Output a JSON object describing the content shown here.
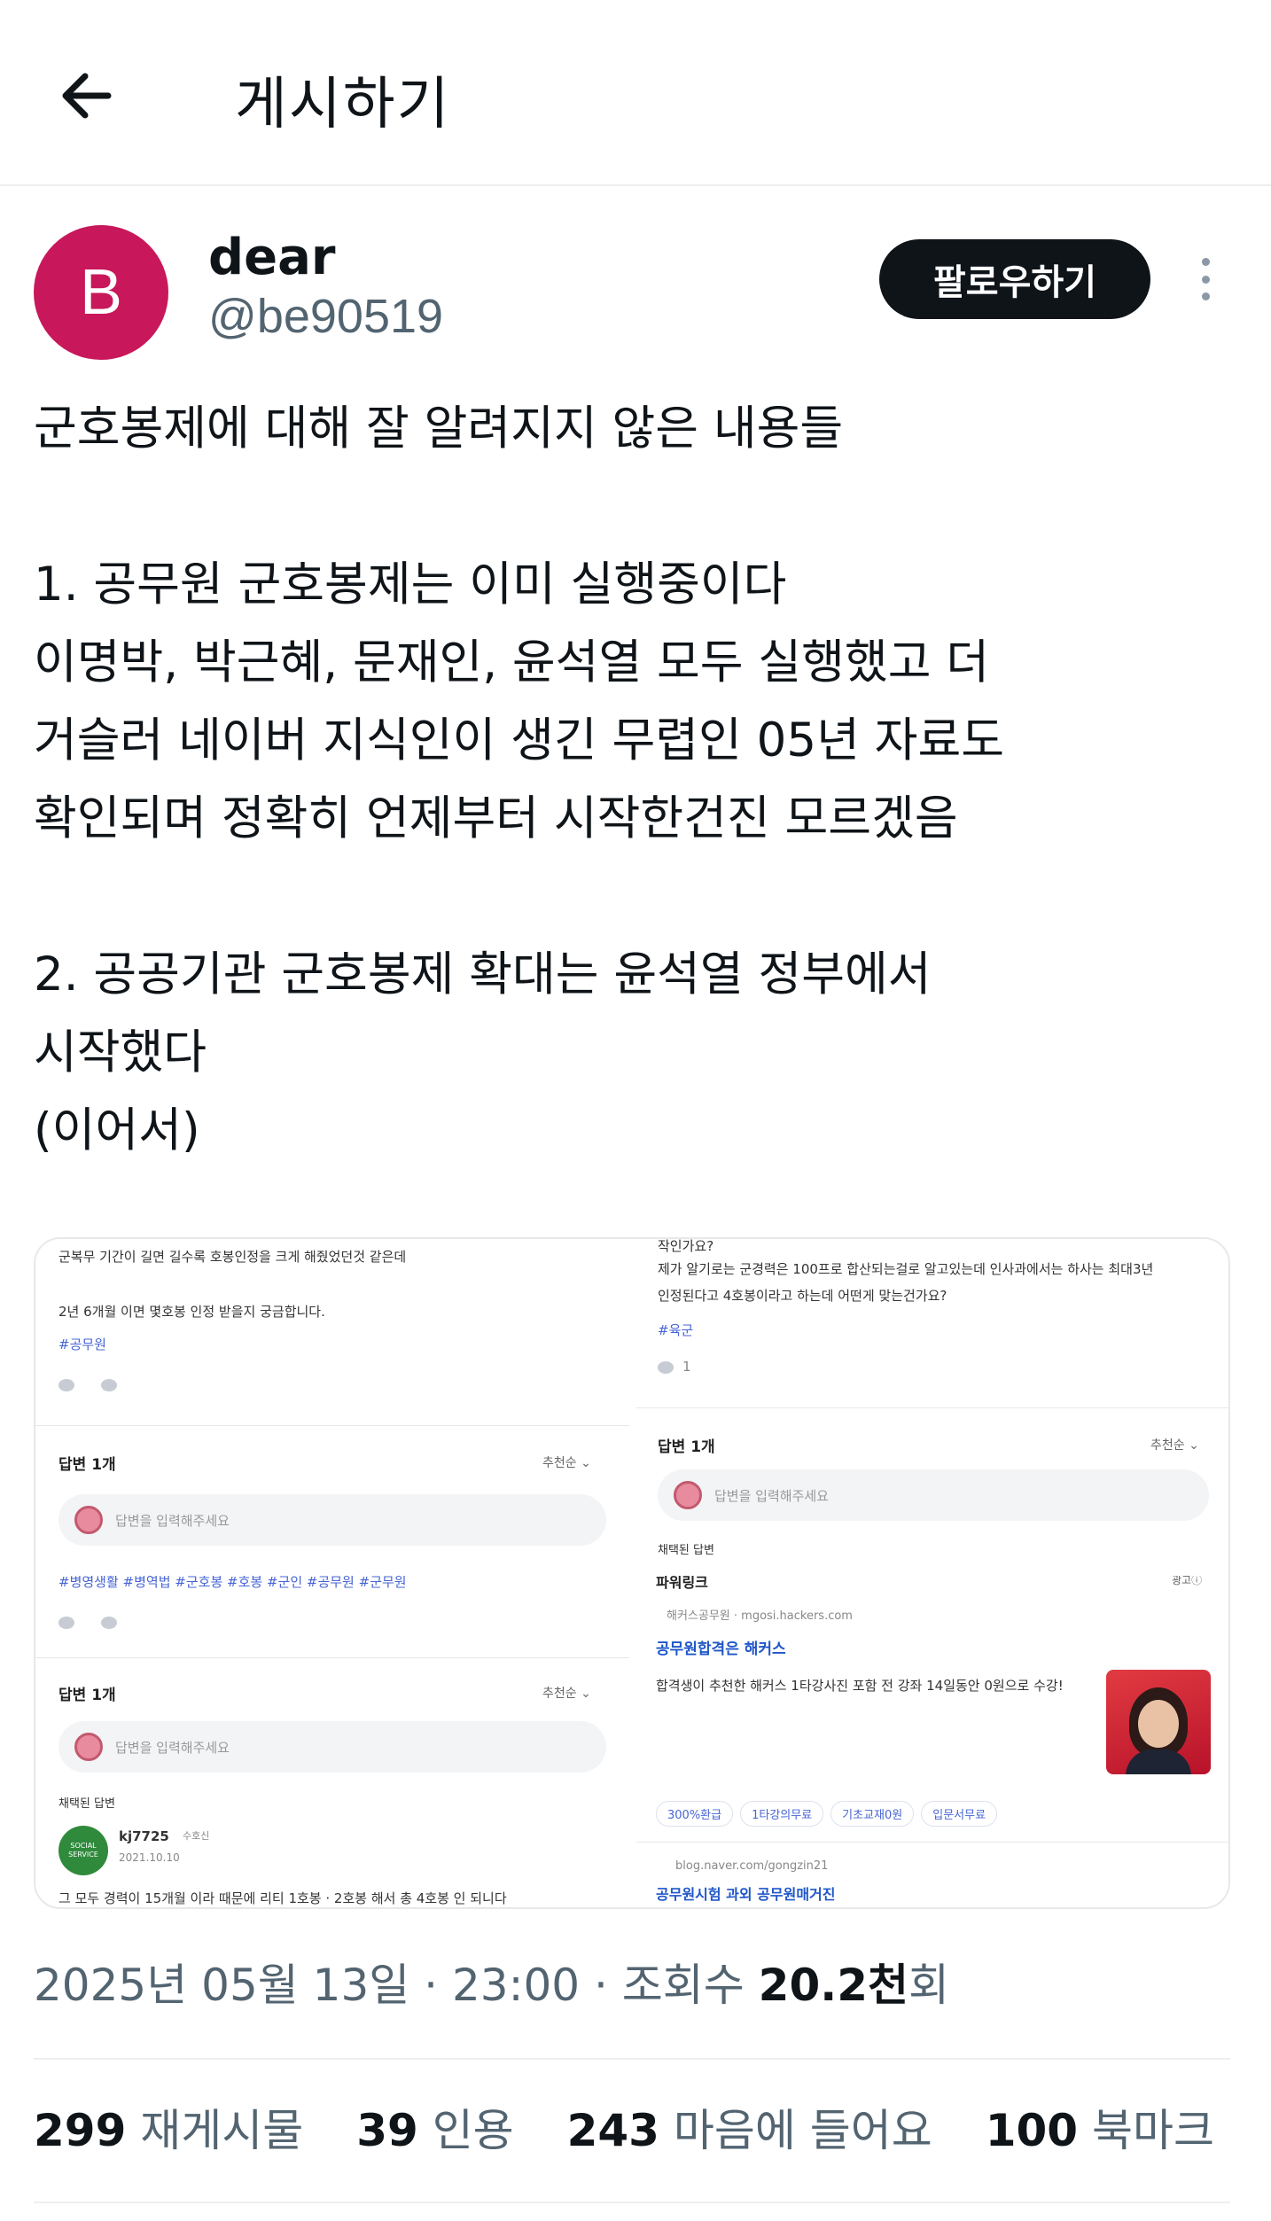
{
  "header": {
    "title": "게시하기",
    "back_icon": "arrow-left-icon"
  },
  "author": {
    "avatar_letter": "B",
    "avatar_color": "#c8175b",
    "name": "dear",
    "handle": "@be90519"
  },
  "follow_label": "팔로우하기",
  "post_lines": [
    "군호봉제에 대해 잘 알려지지 않은 내용들",
    "",
    "1. 공무원 군호봉제는 이미 실행중이다",
    "이명박, 박근혜, 문재인, 윤석열 모두 실행했고 더",
    "거슬러 네이버 지식인이 생긴 무렵인 05년 자료도",
    "확인되며 정확히 언제부터 시작한건진 모르겠음",
    "",
    "2. 공공기관 군호봉제 확대는 윤석열 정부에서",
    "시작했다",
    "(이어서)"
  ],
  "media": {
    "tl": {
      "line1": "군복무 기간이 길면 길수록 호봉인정을 크게 해줬었던것 같은데",
      "line2": "2년 6개월 이면 몇호봉 인정 받을지 궁금합니다.",
      "tag": "#공무원",
      "answers": "답변 1개",
      "sort": "추천순 ⌄",
      "reply_placeholder": "답변을 입력해주세요"
    },
    "tr": {
      "line0": "작인가요?",
      "line1": "제가 알기로는 군경력은 100프로 합산되는걸로 알고있는데 인사과에서는 하사는 최대3년",
      "line2": "인정된다고 4호봉이라고 하는데 어떤게 맞는건가요?",
      "tag": "#육군",
      "count": "1",
      "answers": "답변 1개",
      "sort": "추천순 ⌄",
      "reply_placeholder": "답변을 입력해주세요",
      "chosen": "채택된 답변"
    },
    "bl": {
      "tags": "#병영생활 #병역법 #군호봉 #호봉 #군인 #공무원 #군무원",
      "answers": "답변 1개",
      "sort": "추천순 ⌄",
      "reply_placeholder": "답변을 입력해주세요",
      "chosen": "채택된 답변",
      "user": "kj7725",
      "user_badge": "수호신",
      "date": "2021.10.10",
      "badge_text": "SOCIAL SERVICE",
      "cut_line": "그 모두 경력이 15개월 이라 때문에 리티 1호봉 · 2호봉 해서 총 4호봉 인 되니다"
    },
    "br": {
      "header": "파워링크",
      "ad_label": "광고ⓘ",
      "source": "해커스공무원 · mgosi.hackers.com",
      "title": "공무원합격은 해커스",
      "desc": "합격생이 추천한 해커스 1타강사진 포함 전 강좌 14일동안 0원으로 수강!",
      "chips": [
        "300%환급",
        "1타강의무료",
        "기초교재0원",
        "입문서무료"
      ],
      "source2": "blog.naver.com/gongzin21",
      "title2": "공무원시험 과외 공무원매거진"
    }
  },
  "meta": {
    "date": "2025년 05월 13일",
    "dot1": " · ",
    "time": "23:00",
    "dot2": " · ",
    "views_label": "조회수 ",
    "views_value": "20.2천",
    "views_suffix": "회"
  },
  "stats": {
    "reposts_num": "299",
    "reposts_label": "재게시물",
    "quotes_num": "39",
    "quotes_label": "인용",
    "likes_num": "243",
    "likes_label": "마음에 들어요",
    "bookmarks_num": "100",
    "bookmarks_label": "북마크"
  }
}
